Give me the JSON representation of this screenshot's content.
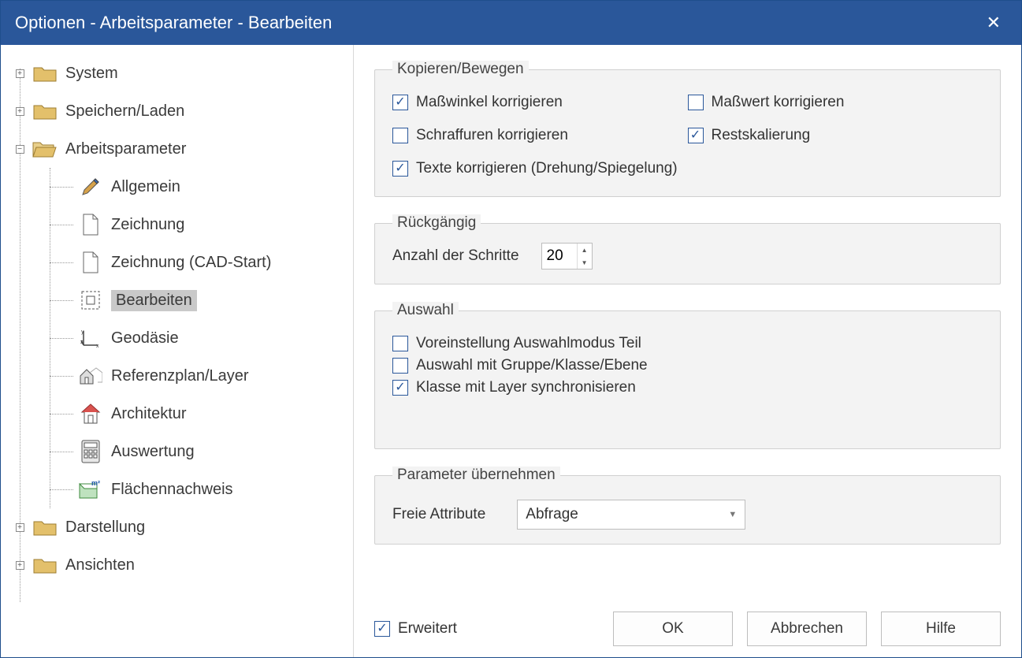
{
  "title": "Optionen - Arbeitsparameter - Bearbeiten",
  "tree": {
    "system": "System",
    "save_load": "Speichern/Laden",
    "work_params": "Arbeitsparameter",
    "children": {
      "allgemein": "Allgemein",
      "zeichnung": "Zeichnung",
      "zeichnung_cad": "Zeichnung (CAD-Start)",
      "bearbeiten": "Bearbeiten",
      "geodaesie": "Geodäsie",
      "referenzplan": "Referenzplan/Layer",
      "architektur": "Architektur",
      "auswertung": "Auswertung",
      "flaechennachweis": "Flächennachweis"
    },
    "darstellung": "Darstellung",
    "ansichten": "Ansichten"
  },
  "groups": {
    "copy_move": {
      "legend": "Kopieren/Bewegen",
      "masswinkel": {
        "label": "Maßwinkel korrigieren",
        "checked": true
      },
      "masswert": {
        "label": "Maßwert korrigieren",
        "checked": false
      },
      "schraffuren": {
        "label": "Schraffuren korrigieren",
        "checked": false
      },
      "restskalierung": {
        "label": "Restskalierung",
        "checked": true
      },
      "texte": {
        "label": "Texte korrigieren (Drehung/Spiegelung)",
        "checked": true
      }
    },
    "undo": {
      "legend": "Rückgängig",
      "steps_label": "Anzahl der Schritte",
      "steps_value": "20"
    },
    "selection": {
      "legend": "Auswahl",
      "voreinstellung": {
        "label": "Voreinstellung Auswahlmodus Teil",
        "checked": false
      },
      "gruppe": {
        "label": "Auswahl mit Gruppe/Klasse/Ebene",
        "checked": false
      },
      "klasse_layer": {
        "label": "Klasse mit Layer synchronisieren",
        "checked": true
      }
    },
    "adopt_params": {
      "legend": "Parameter übernehmen",
      "attr_label": "Freie Attribute",
      "attr_value": "Abfrage"
    }
  },
  "footer": {
    "erweitert": {
      "label": "Erweitert",
      "checked": true
    },
    "ok": "OK",
    "cancel": "Abbrechen",
    "help": "Hilfe"
  }
}
